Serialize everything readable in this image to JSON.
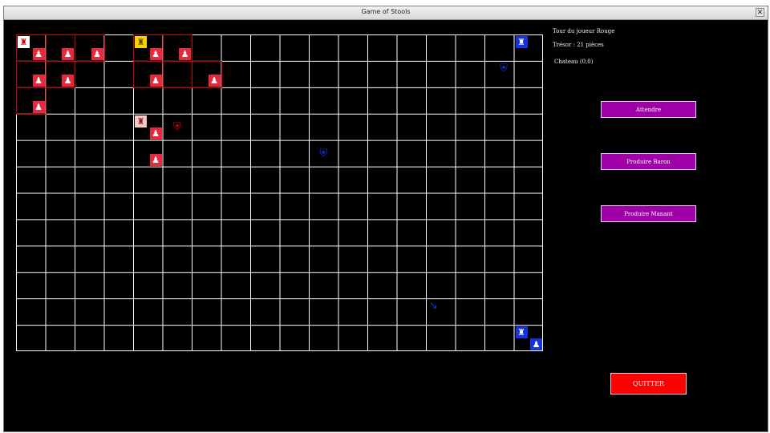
{
  "window": {
    "title": "Game of Stools",
    "close_glyph": "✕"
  },
  "board": {
    "cols": 18,
    "rows": 12,
    "grid_color": "#ffffff",
    "red_cells": [
      [
        0,
        0
      ],
      [
        1,
        0
      ],
      [
        2,
        0
      ],
      [
        4,
        0
      ],
      [
        5,
        0
      ],
      [
        0,
        1
      ],
      [
        1,
        1
      ],
      [
        4,
        1
      ],
      [
        5,
        1
      ],
      [
        6,
        1
      ],
      [
        0,
        2
      ]
    ],
    "pieces": [
      {
        "name": "red-castle",
        "kind": "castle",
        "style": "white",
        "col": 0,
        "row": 0,
        "pos": "tl",
        "glyph": "♜"
      },
      {
        "name": "red-unit",
        "kind": "unit",
        "style": "red",
        "col": 0,
        "row": 0,
        "pos": "br",
        "glyph": "♟"
      },
      {
        "name": "red-unit",
        "kind": "unit",
        "style": "red",
        "col": 1,
        "row": 0,
        "pos": "br",
        "glyph": "♟"
      },
      {
        "name": "red-unit",
        "kind": "unit",
        "style": "red",
        "col": 2,
        "row": 0,
        "pos": "br",
        "glyph": "♟"
      },
      {
        "name": "yellow-castle",
        "kind": "castle",
        "style": "yellow",
        "col": 4,
        "row": 0,
        "pos": "tl",
        "glyph": "♜"
      },
      {
        "name": "red-unit",
        "kind": "unit",
        "style": "red",
        "col": 4,
        "row": 0,
        "pos": "br",
        "glyph": "♟"
      },
      {
        "name": "red-unit",
        "kind": "unit",
        "style": "red",
        "col": 5,
        "row": 0,
        "pos": "br",
        "glyph": "♟"
      },
      {
        "name": "red-unit",
        "kind": "unit",
        "style": "red",
        "col": 0,
        "row": 1,
        "pos": "br",
        "glyph": "♟"
      },
      {
        "name": "red-unit",
        "kind": "unit",
        "style": "red",
        "col": 1,
        "row": 1,
        "pos": "br",
        "glyph": "♟"
      },
      {
        "name": "red-unit",
        "kind": "unit",
        "style": "red",
        "col": 4,
        "row": 1,
        "pos": "br",
        "glyph": "♟"
      },
      {
        "name": "red-unit",
        "kind": "unit",
        "style": "red",
        "col": 6,
        "row": 1,
        "pos": "br",
        "glyph": "♟"
      },
      {
        "name": "red-unit",
        "kind": "unit",
        "style": "red",
        "col": 0,
        "row": 2,
        "pos": "br",
        "glyph": "♟"
      },
      {
        "name": "neutral-castle",
        "kind": "castle",
        "style": "pink",
        "col": 4,
        "row": 3,
        "pos": "tl",
        "glyph": "♜"
      },
      {
        "name": "red-unit",
        "kind": "unit",
        "style": "red",
        "col": 4,
        "row": 3,
        "pos": "br",
        "glyph": "♟"
      },
      {
        "name": "red-unit",
        "kind": "unit",
        "style": "red",
        "col": 4,
        "row": 4,
        "pos": "br",
        "glyph": "♟"
      },
      {
        "name": "red-enemy-icon",
        "kind": "icon",
        "style": "ghost-red",
        "col": 5,
        "row": 3,
        "pos": "c",
        "glyph": "⛨"
      },
      {
        "name": "blue-enemy-icon",
        "kind": "icon",
        "style": "ghost-blue",
        "col": 10,
        "row": 4,
        "pos": "c",
        "glyph": "⛨"
      },
      {
        "name": "blue-enemy-icon",
        "kind": "icon",
        "style": "ghost-blue",
        "col": 16,
        "row": 1,
        "pos": "tr",
        "glyph": "⛨"
      },
      {
        "name": "blue-castle",
        "kind": "castle",
        "style": "blue-fill",
        "col": 17,
        "row": 0,
        "pos": "tl",
        "glyph": "♜"
      },
      {
        "name": "blue-castle",
        "kind": "castle",
        "style": "blue-fill",
        "col": 17,
        "row": 11,
        "pos": "tl",
        "glyph": "♜"
      },
      {
        "name": "blue-unit",
        "kind": "unit",
        "style": "blue-fill",
        "col": 17,
        "row": 11,
        "pos": "br",
        "glyph": "♟"
      },
      {
        "name": "blue-arrow-icon",
        "kind": "icon",
        "style": "ghost-blue",
        "col": 14,
        "row": 10,
        "pos": "tl",
        "glyph": "↘"
      }
    ]
  },
  "side": {
    "turn_text": "Tour du joueur Rouge",
    "treasury_text": "Trésor : 21 pièces",
    "selection_text": "Chateau (0,0)"
  },
  "actions": {
    "wait_label": "Attendre",
    "produce_baron_label": "Produire Baron",
    "produce_manant_label": "Produire Manant",
    "quit_label": "QUITTER"
  },
  "colors": {
    "background": "#000000",
    "purple_button": "#a000a8",
    "red_button": "#ff0000",
    "red_player": "#e8283c",
    "blue_player": "#1433e0",
    "yellow_player": "#f2d600"
  }
}
